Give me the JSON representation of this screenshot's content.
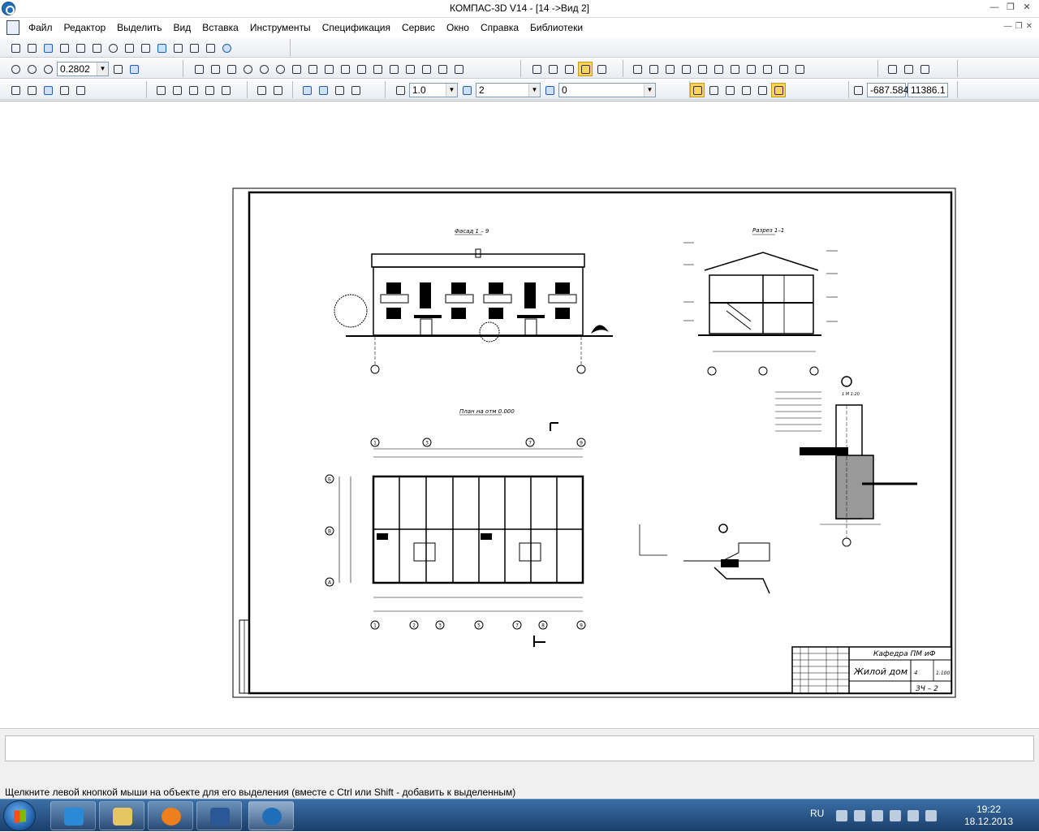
{
  "window": {
    "title": "КОМПАС-3D V14 - [14 ->Вид 2]"
  },
  "menu": {
    "items": [
      "Файл",
      "Редактор",
      "Выделить",
      "Вид",
      "Вставка",
      "Инструменты",
      "Спецификация",
      "Сервис",
      "Окно",
      "Справка",
      "Библиотеки"
    ]
  },
  "toolbar": {
    "zoom_value": "0.2802",
    "line_scale": "1.0",
    "view_number": "2",
    "layer": "0",
    "coord_x": "-687.584",
    "coord_y": "11386.1"
  },
  "drawing": {
    "facade_title": "Фасад 1 – 9",
    "section_title": "Разрез 1–1",
    "plan_title": "План на отм 0.000",
    "node_title": "1  М 1:20",
    "stamp": {
      "dept": "Кафедра ПМ иФ",
      "name": "Жилой дом",
      "sheet": "4",
      "scale": "1:100",
      "code": "ЗЧ – 2"
    },
    "axes_top": [
      "1",
      "3",
      "7",
      "9"
    ],
    "axes_bottom": [
      "1",
      "2",
      "3",
      "5",
      "7",
      "8",
      "9"
    ],
    "axes_left": [
      "Б",
      "В",
      "А"
    ]
  },
  "status": {
    "hint": "Щелкните левой кнопкой мыши на объекте для его выделения (вместе с Ctrl или Shift - добавить к выделенным)"
  },
  "taskbar": {
    "lang": "RU",
    "time": "19:22",
    "date": "18.12.2013",
    "app_icons": [
      "ie-icon",
      "explorer-icon",
      "media-player-icon",
      "word-icon",
      "kompas-icon"
    ]
  },
  "colors": {
    "accent": "#ffd35a",
    "taskbar": "#1c3f6b",
    "kompas_blue": "#1f6fb8"
  }
}
